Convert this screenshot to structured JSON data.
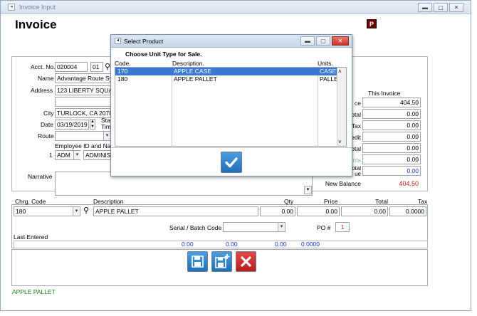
{
  "window": {
    "title": "Invoice Input"
  },
  "page_title": "Invoice",
  "p_badge": "P",
  "header": {
    "acct_label": "Acct. No.",
    "acct_value": "020004",
    "acct_suffix": "01",
    "name_label": "Name",
    "name_value": "Advantage Route Sys",
    "address_label": "Address",
    "address_value": "123 LIBERTY SQUA",
    "city_label": "City",
    "city_value": "TURLOCK, CA  2078",
    "date_label": "Date",
    "date_value": "03/19/2019",
    "sta_label": "Sta",
    "tim_label": "Tim",
    "route_label": "Route",
    "employee_label": "Employee ID and Nar",
    "employee_index": "1",
    "employee_id": "ADM",
    "employee_name": "ADMINIST",
    "narrative_label": "Narrative"
  },
  "totals": {
    "this_invoice_label": "This Invoice",
    "rows": [
      {
        "label": "ce",
        "value": "404.50"
      },
      {
        "label": "otal",
        "value": "0.00"
      },
      {
        "label": "Tax",
        "value": "0.00"
      },
      {
        "label": "edit",
        "value": "0.00"
      },
      {
        "label": "otal",
        "value": "0.00"
      },
      {
        "label": "nts",
        "value": "0.00"
      },
      {
        "label": "otal\nue",
        "value": "0.00"
      }
    ],
    "new_balance_label": "New Balance",
    "new_balance_value": "404.50",
    "colors": {
      "blue": "#1a33cc",
      "red": "#cc1a1a"
    }
  },
  "line_item": {
    "headers": {
      "chrg_code": "Chrg. Code",
      "description": "Description",
      "qty": "Qty",
      "price": "Price",
      "total": "Total",
      "tax": "Tax"
    },
    "code": "180",
    "description": "APPLE PALLET",
    "qty": "0.00",
    "price": "0.00",
    "total": "0.00",
    "tax": "0.0000",
    "serial_label": "Serial / Batch Code",
    "po_label": "PO #",
    "po_value": "1",
    "last_entered_label": "Last Entered",
    "summary_values": [
      "0.00",
      "0.00",
      "0.00",
      "0.0000"
    ]
  },
  "status_text": "APPLE PALLET",
  "dialog": {
    "title": "Select Product",
    "prompt": "Choose Unit Type for Sale.",
    "columns": {
      "code": "Code.",
      "description": "Description.",
      "units": "Units."
    },
    "rows": [
      {
        "code": "170",
        "description": "APPLE CASE",
        "units": "CASE",
        "selected": true
      },
      {
        "code": "180",
        "description": "APPLE PALLET",
        "units": "PALLE",
        "selected": false
      }
    ]
  }
}
